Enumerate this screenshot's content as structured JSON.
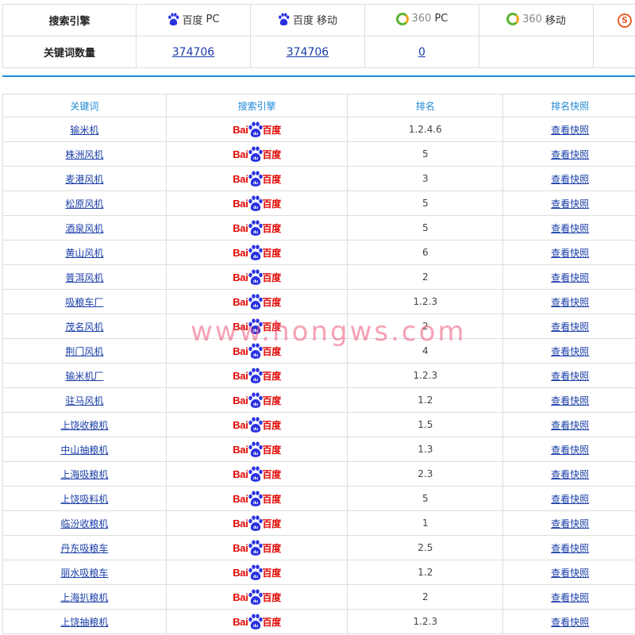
{
  "summary": {
    "header_label": "搜索引擎",
    "count_label": "关键词数量",
    "engines": [
      {
        "icon": "baidu-paw-icon",
        "brand": "百度",
        "suffix": "PC",
        "count": "374706"
      },
      {
        "icon": "baidu-paw-icon",
        "brand": "百度",
        "suffix": "移动",
        "count": "374706"
      },
      {
        "icon": "360-icon",
        "brand": "360",
        "suffix": "PC",
        "count": "0"
      },
      {
        "icon": "360-icon",
        "brand": "360",
        "suffix": "移动",
        "count": ""
      },
      {
        "icon": "sogou-icon",
        "brand": "S",
        "suffix": "",
        "count": ""
      }
    ]
  },
  "table": {
    "headers": [
      "关键词",
      "搜索引擎",
      "排名",
      "排名快照"
    ],
    "engine_logo": {
      "latin": "Bai",
      "cn": "百度",
      "paw_text": "du"
    },
    "snapshot_label": "查看快照",
    "rows": [
      {
        "keyword": "输米机",
        "rank": "1.2.4.6"
      },
      {
        "keyword": "株洲风机",
        "rank": "5"
      },
      {
        "keyword": "麦港风机",
        "rank": "3"
      },
      {
        "keyword": "松原风机",
        "rank": "5"
      },
      {
        "keyword": "酒泉风机",
        "rank": "5"
      },
      {
        "keyword": "黄山风机",
        "rank": "6"
      },
      {
        "keyword": "普洱风机",
        "rank": "2"
      },
      {
        "keyword": "吸粮车厂",
        "rank": "1.2.3"
      },
      {
        "keyword": "茂名风机",
        "rank": "2"
      },
      {
        "keyword": "荆门风机",
        "rank": "4"
      },
      {
        "keyword": "输米机厂",
        "rank": "1.2.3"
      },
      {
        "keyword": "驻马风机",
        "rank": "1.2"
      },
      {
        "keyword": "上饶收粮机",
        "rank": "1.5"
      },
      {
        "keyword": "中山抽粮机",
        "rank": "1.3"
      },
      {
        "keyword": "上海吸粮机",
        "rank": "2.3"
      },
      {
        "keyword": "上饶吸料机",
        "rank": "5"
      },
      {
        "keyword": "临汾收粮机",
        "rank": "1"
      },
      {
        "keyword": "丹东吸粮车",
        "rank": "2.5"
      },
      {
        "keyword": "丽水吸粮车",
        "rank": "1.2"
      },
      {
        "keyword": "上海扒粮机",
        "rank": "2"
      },
      {
        "keyword": "上饶抽粮机",
        "rank": "1.2.3"
      }
    ]
  },
  "watermark": "www.hongws.com",
  "colors": {
    "link": "#1a3ea8",
    "header": "#1f8ad6",
    "baidu_red": "#e10602",
    "baidu_blue": "#2932e1",
    "divider": "#1f8ad6"
  }
}
